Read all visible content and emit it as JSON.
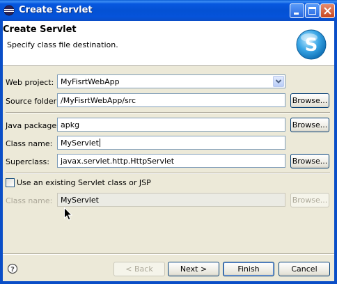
{
  "window": {
    "title": "Create Servlet"
  },
  "banner": {
    "heading": "Create Servlet",
    "subtitle": "Specify class file destination.",
    "logo_letter": "S"
  },
  "form": {
    "web_project": {
      "label": "Web project:",
      "value": "MyFisrtWebApp"
    },
    "source_folder": {
      "label": "Source folder:",
      "value": "/MyFisrtWebApp/src",
      "browse": "Browse..."
    },
    "java_package": {
      "label": "Java package:",
      "value": "apkg",
      "browse": "Browse..."
    },
    "class_name": {
      "label": "Class name:",
      "value": "MyServlet"
    },
    "superclass": {
      "label": "Superclass:",
      "value": "javax.servlet.http.HttpServlet",
      "browse": "Browse..."
    },
    "use_existing": {
      "label": "Use an existing Servlet class or JSP",
      "checked": false
    },
    "existing_class_name": {
      "label": "Class name:",
      "value": "MyServlet",
      "browse": "Browse..."
    }
  },
  "footer": {
    "help_icon": "help-icon",
    "back": "< Back",
    "next": "Next >",
    "finish": "Finish",
    "cancel": "Cancel"
  },
  "colors": {
    "titlebar": "#0451d3",
    "dialog_bg": "#ece9d8",
    "field_border": "#7f9db9",
    "disabled_text": "#aca899"
  }
}
